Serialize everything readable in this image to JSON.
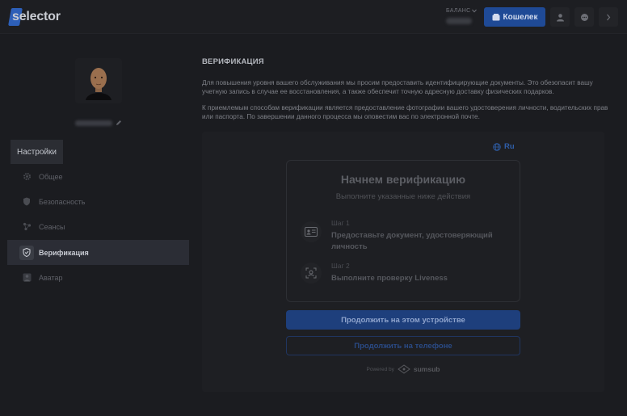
{
  "header": {
    "logo_text": "selector",
    "balance_label": "БАЛАНС",
    "wallet_label": "Кошелек",
    "icons": [
      "user-icon",
      "chat-icon",
      "chevron-right-icon"
    ],
    "accent_color": "#1f4a96"
  },
  "sidebar": {
    "settings_tab": "Настройки",
    "items": [
      {
        "label": "Общее",
        "icon": "gear-icon",
        "active": false
      },
      {
        "label": "Безопасность",
        "icon": "shield-icon",
        "active": false
      },
      {
        "label": "Сеансы",
        "icon": "sessions-icon",
        "active": false
      },
      {
        "label": "Верификация",
        "icon": "verified-shield-icon",
        "active": true
      },
      {
        "label": "Аватар",
        "icon": "avatar-icon",
        "active": false
      }
    ]
  },
  "main": {
    "title": "ВЕРИФИКАЦИЯ",
    "paragraph1": "Для повышения уровня вашего обслуживания мы просим предоставить идентифицирующие документы. Это обезопасит вашу учетную запись в случае ее восстановления, а также обеспечит точную адресную доставку физических подарков.",
    "paragraph2": "К приемлемым способам верификации является предоставление фотографии вашего удостоверения личности, водительских прав или паспорта. По завершении данного процесса мы оповестим вас по электронной почте.",
    "verification": {
      "language": "Ru",
      "title": "Начнем верификацию",
      "subtitle": "Выполните указанные ниже действия",
      "steps": [
        {
          "label": "Шаг 1",
          "text": "Предоставьте документ, удостоверяющий личность",
          "icon": "id-card-icon"
        },
        {
          "label": "Шаг 2",
          "text": "Выполните проверку Liveness",
          "icon": "face-scan-icon"
        }
      ],
      "primary_button": "Продолжить на этом устройстве",
      "secondary_button": "Продолжить на телефоне",
      "powered_by": "Powered by",
      "powered_brand": "sumsub"
    }
  }
}
